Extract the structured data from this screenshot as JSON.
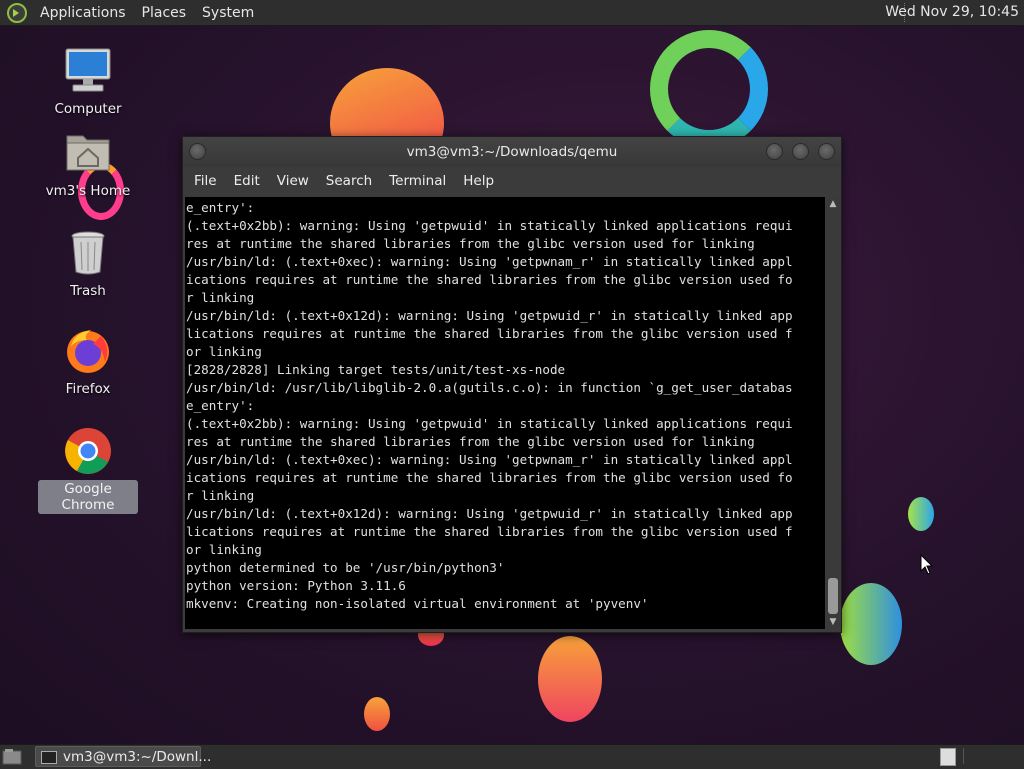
{
  "top_panel": {
    "menus": [
      "Applications",
      "Places",
      "System"
    ],
    "clock": "Wed Nov 29, 10:45"
  },
  "desktop_icons": [
    {
      "label": "Computer",
      "icon": "computer-icon"
    },
    {
      "label": "vm3's Home",
      "icon": "home-folder-icon"
    },
    {
      "label": "Trash",
      "icon": "trash-icon"
    },
    {
      "label": "Firefox",
      "icon": "firefox-icon"
    },
    {
      "label": "Google Chrome",
      "icon": "chrome-icon",
      "selected": true
    }
  ],
  "terminal": {
    "title": "vm3@vm3:~/Downloads/qemu",
    "menus": [
      "File",
      "Edit",
      "View",
      "Search",
      "Terminal",
      "Help"
    ],
    "lines": [
      "e_entry':",
      "(.text+0x2bb): warning: Using 'getpwuid' in statically linked applications requi",
      "res at runtime the shared libraries from the glibc version used for linking",
      "/usr/bin/ld: (.text+0xec): warning: Using 'getpwnam_r' in statically linked appl",
      "ications requires at runtime the shared libraries from the glibc version used fo",
      "r linking",
      "/usr/bin/ld: (.text+0x12d): warning: Using 'getpwuid_r' in statically linked app",
      "lications requires at runtime the shared libraries from the glibc version used f",
      "or linking",
      "[2828/2828] Linking target tests/unit/test-xs-node",
      "/usr/bin/ld: /usr/lib/libglib-2.0.a(gutils.c.o): in function `g_get_user_databas",
      "e_entry':",
      "(.text+0x2bb): warning: Using 'getpwuid' in statically linked applications requi",
      "res at runtime the shared libraries from the glibc version used for linking",
      "/usr/bin/ld: (.text+0xec): warning: Using 'getpwnam_r' in statically linked appl",
      "ications requires at runtime the shared libraries from the glibc version used fo",
      "r linking",
      "/usr/bin/ld: (.text+0x12d): warning: Using 'getpwuid_r' in statically linked app",
      "lications requires at runtime the shared libraries from the glibc version used f",
      "or linking",
      "python determined to be '/usr/bin/python3'",
      "python version: Python 3.11.6",
      "mkvenv: Creating non-isolated virtual environment at 'pyvenv'"
    ]
  },
  "taskbar": {
    "task_label": "vm3@vm3:~/Downl..."
  },
  "colors": {
    "panel": "#2e2e2e",
    "terminal_bg": "#000000",
    "terminal_fg": "#e0e0e0",
    "selection": "#7f7f8a"
  }
}
